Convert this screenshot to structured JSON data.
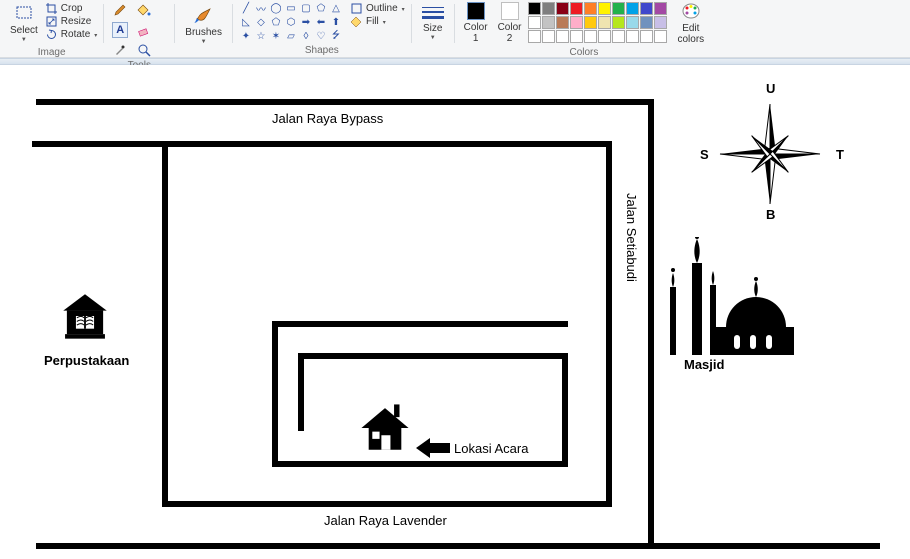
{
  "ribbon": {
    "image": {
      "group": "Image",
      "select": "Select",
      "crop": "Crop",
      "resize": "Resize",
      "rotate": "Rotate"
    },
    "tools": {
      "group": "Tools"
    },
    "brushes": {
      "group": "Brushes",
      "label": "Brushes"
    },
    "shapes": {
      "group": "Shapes",
      "outline": "Outline",
      "fill": "Fill"
    },
    "size": {
      "group": "",
      "label": "Size"
    },
    "colors": {
      "group": "Colors",
      "c1a": "Color",
      "c1b": "1",
      "c2a": "Color",
      "c2b": "2",
      "edit": "Edit",
      "editb": "colors",
      "palette": [
        "#000000",
        "#7f7f7f",
        "#880015",
        "#ed1c24",
        "#ff7f27",
        "#fff200",
        "#22b14c",
        "#00a2e8",
        "#3f48cc",
        "#a349a4",
        "#ffffff",
        "#c3c3c3",
        "#b97a57",
        "#ffaec9",
        "#ffc90e",
        "#efe4b0",
        "#b5e61d",
        "#99d9ea",
        "#7092be",
        "#c8bfe7",
        "#ffffff",
        "#ffffff",
        "#ffffff",
        "#ffffff",
        "#ffffff",
        "#ffffff",
        "#ffffff",
        "#ffffff",
        "#ffffff",
        "#ffffff"
      ]
    }
  },
  "map": {
    "road_bypass": "Jalan Raya Bypass",
    "road_setiabudi": "Jalan Setiabudi",
    "road_lavender": "Jalan Raya Lavender",
    "library": "Perpustakaan",
    "mosque": "Masjid",
    "event_location": "Lokasi Acara",
    "compass": {
      "n": "U",
      "e": "T",
      "s": "B",
      "w": "S"
    }
  }
}
